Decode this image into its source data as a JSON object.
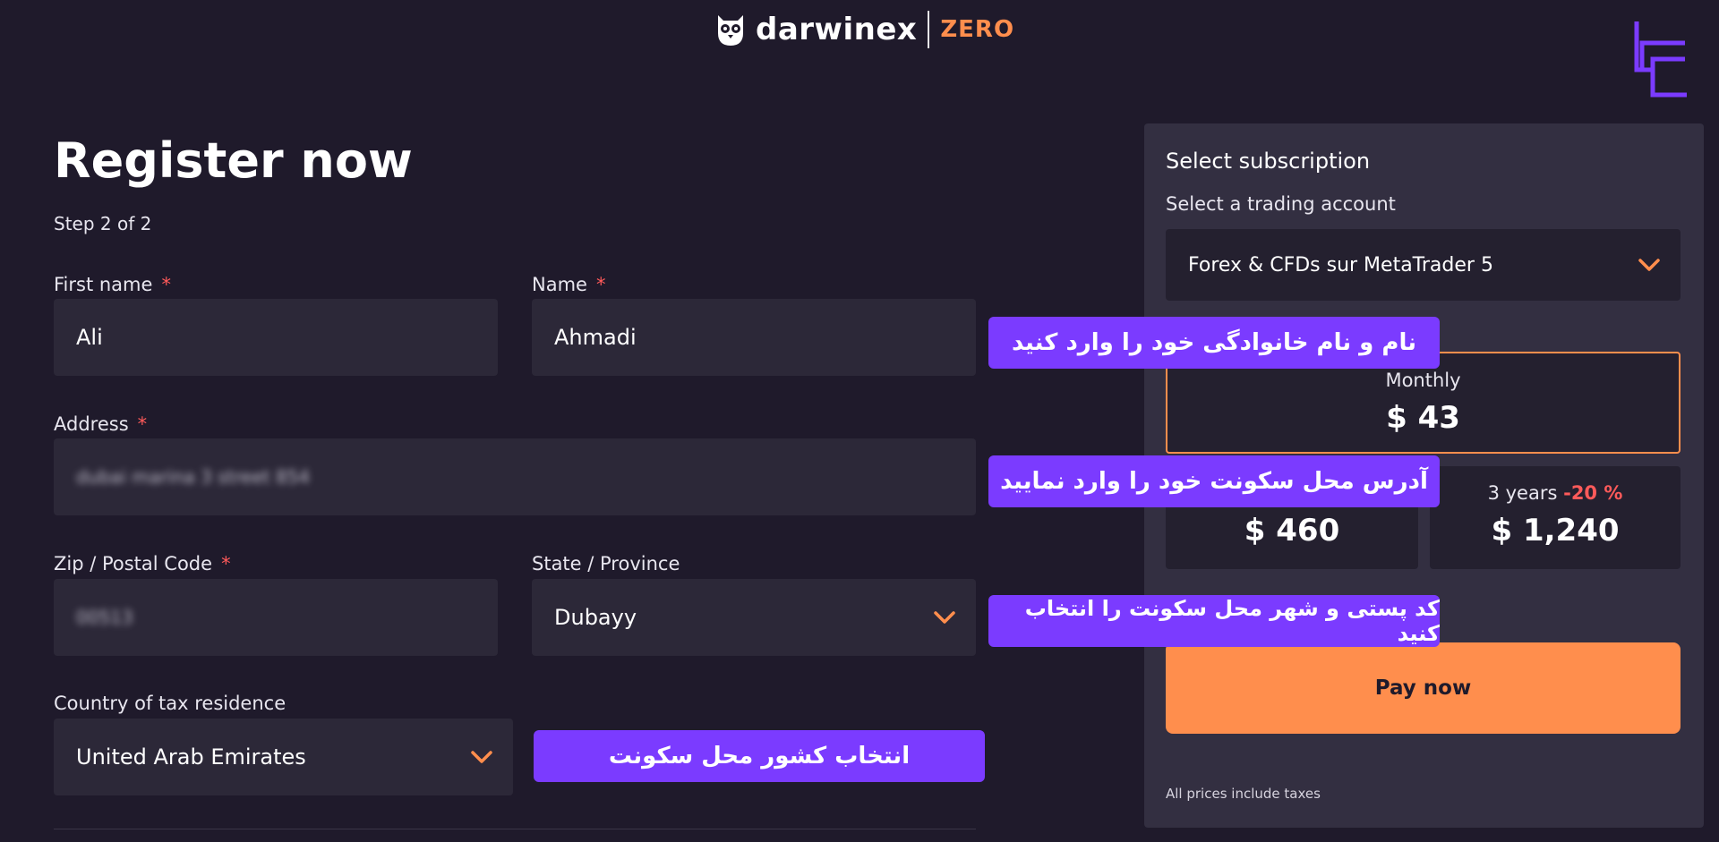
{
  "header": {
    "brand": "darwinex",
    "brand_suffix": "ZERO"
  },
  "form": {
    "title": "Register now",
    "step": "Step 2 of 2",
    "first_name": {
      "label": "First name",
      "required": "*",
      "value": "Ali"
    },
    "last_name": {
      "label": "Name",
      "required": "*",
      "value": "Ahmadi"
    },
    "address": {
      "label": "Address",
      "required": "*",
      "value": "dubai marina 3 street 854"
    },
    "zip": {
      "label": "Zip / Postal Code",
      "required": "*",
      "value": "00513"
    },
    "state": {
      "label": "State / Province",
      "value": "Dubayy"
    },
    "country": {
      "label": "Country of tax residence",
      "value": "United Arab Emirates"
    }
  },
  "callouts": {
    "name": "نام و نام خانوادگی خود را وارد کنید",
    "address": "آدرس محل سکونت خود را وارد نمایید",
    "zip_city": "کد پستی و شهر محل سکونت را انتخاب کنید",
    "country": "انتخاب کشور محل سکونت"
  },
  "subscription": {
    "title": "Select subscription",
    "account_label": "Select a trading account",
    "account_value": "Forex & CFDs sur MetaTrader 5",
    "plans": [
      {
        "period": "Monthly",
        "price": "$ 43",
        "selected": true
      },
      {
        "period": "",
        "price": "$ 460"
      },
      {
        "period": "3 years",
        "discount": "-20 %",
        "price": "$ 1,240"
      }
    ],
    "pay_label": "Pay now",
    "taxes_note": "All prices include taxes"
  },
  "colors": {
    "background": "#1f1a2b",
    "accent": "#ff8e4d",
    "callout": "#7b3bff",
    "required": "#ff5a5a"
  },
  "icons": [
    "owl-logo-icon",
    "chevron-down-icon",
    "brand-corner-mark-icon"
  ]
}
